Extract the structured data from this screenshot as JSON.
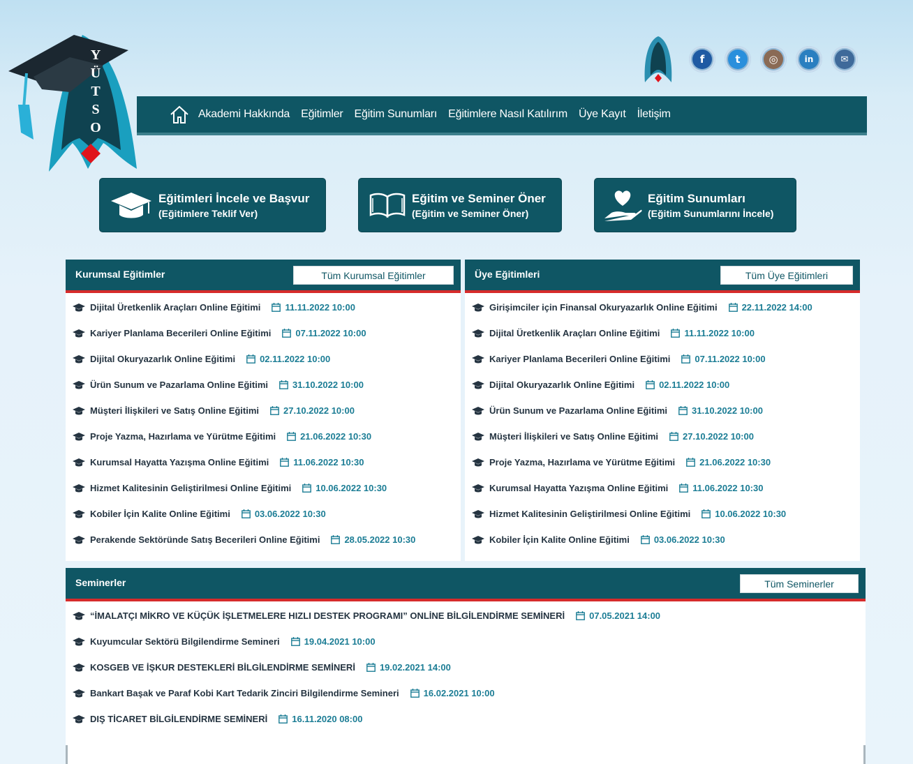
{
  "logo": {
    "letters": [
      "Y",
      "Ü",
      "T",
      "S",
      "O"
    ],
    "alt": "YÜTSO"
  },
  "social": {
    "icons": [
      "emblem-icon",
      "facebook-icon",
      "twitter-icon",
      "instagram-icon",
      "linkedin-icon",
      "email-icon"
    ]
  },
  "nav": {
    "items": [
      "Akademi Hakkında",
      "Eğitimler",
      "Eğitim Sunumları",
      "Eğitimlere Nasıl Katılırım",
      "Üye Kayıt",
      "İletişim"
    ]
  },
  "actions": [
    {
      "title": "Eğitimleri İncele ve Başvur",
      "subtitle": "(Eğitimlere Teklif Ver)",
      "icon": "graduation-cap-icon"
    },
    {
      "title": "Eğitim ve Seminer Öner",
      "subtitle": "(Eğitim ve Seminer Öner)",
      "icon": "open-book-icon"
    },
    {
      "title": "Eğitim Sunumları",
      "subtitle": "(Eğitim Sunumlarını İncele)",
      "icon": "heart-hand-icon"
    }
  ],
  "corporate": {
    "title": "Kurumsal Eğitimler",
    "all_label": "Tüm Kurumsal Eğitimler",
    "items": [
      {
        "title": "Dijital Üretkenlik Araçları Online Eğitimi",
        "date": "11.11.2022 10:00"
      },
      {
        "title": "Kariyer Planlama Becerileri Online Eğitimi",
        "date": "07.11.2022 10:00"
      },
      {
        "title": "Dijital Okuryazarlık Online Eğitimi",
        "date": "02.11.2022 10:00"
      },
      {
        "title": "Ürün Sunum ve Pazarlama Online Eğitimi",
        "date": "31.10.2022 10:00"
      },
      {
        "title": "Müşteri İlişkileri ve Satış Online Eğitimi",
        "date": "27.10.2022 10:00"
      },
      {
        "title": "Proje Yazma, Hazırlama ve Yürütme Eğitimi",
        "date": "21.06.2022 10:30"
      },
      {
        "title": "Kurumsal Hayatta Yazışma Online Eğitimi",
        "date": "11.06.2022 10:30"
      },
      {
        "title": "Hizmet Kalitesinin Geliştirilmesi Online Eğitimi",
        "date": "10.06.2022 10:30"
      },
      {
        "title": "Kobiler İçin Kalite Online Eğitimi",
        "date": "03.06.2022 10:30"
      },
      {
        "title": "Perakende Sektöründe Satış Becerileri Online Eğitimi",
        "date": "28.05.2022 10:30"
      }
    ]
  },
  "member": {
    "title": "Üye Eğitimleri",
    "all_label": "Tüm Üye Eğitimleri",
    "items": [
      {
        "title": "Girişimciler için Finansal Okuryazarlık Online Eğitimi",
        "date": "22.11.2022 14:00"
      },
      {
        "title": "Dijital Üretkenlik Araçları Online Eğitimi",
        "date": "11.11.2022 10:00"
      },
      {
        "title": "Kariyer Planlama Becerileri Online Eğitimi",
        "date": "07.11.2022 10:00"
      },
      {
        "title": "Dijital Okuryazarlık Online Eğitimi",
        "date": "02.11.2022 10:00"
      },
      {
        "title": "Ürün Sunum ve Pazarlama Online Eğitimi",
        "date": "31.10.2022 10:00"
      },
      {
        "title": "Müşteri İlişkileri ve Satış Online Eğitimi",
        "date": "27.10.2022 10:00"
      },
      {
        "title": "Proje Yazma, Hazırlama ve Yürütme Eğitimi",
        "date": "21.06.2022 10:30"
      },
      {
        "title": "Kurumsal Hayatta Yazışma Online Eğitimi",
        "date": "11.06.2022 10:30"
      },
      {
        "title": "Hizmet Kalitesinin Geliştirilmesi Online Eğitimi",
        "date": "10.06.2022 10:30"
      },
      {
        "title": "Kobiler İçin Kalite Online Eğitimi",
        "date": "03.06.2022 10:30"
      }
    ]
  },
  "seminars": {
    "title": "Seminerler",
    "all_label": "Tüm Seminerler",
    "items": [
      {
        "title": "“İMALATÇI MİKRO VE KÜÇÜK İŞLETMELERE HIZLI DESTEK PROGRAMI” ONLİNE BİLGİLENDİRME SEMİNERİ",
        "date": "07.05.2021 14:00"
      },
      {
        "title": "Kuyumcular Sektörü Bilgilendirme Semineri",
        "date": "19.04.2021 10:00"
      },
      {
        "title": "KOSGEB VE İŞKUR DESTEKLERİ BİLGİLENDİRME SEMİNERİ",
        "date": "19.02.2021 14:00"
      },
      {
        "title": "Bankart Başak ve Paraf Kobi Kart Tedarik Zinciri Bilgilendirme Semineri",
        "date": "16.02.2021 10:00"
      },
      {
        "title": "DIŞ TİCARET BİLGİLENDİRME SEMİNERİ",
        "date": "16.11.2020 08:00"
      }
    ]
  },
  "colors": {
    "brand": "#0f5664",
    "accent_red": "#d62b2b",
    "date_text": "#1c7d95"
  }
}
